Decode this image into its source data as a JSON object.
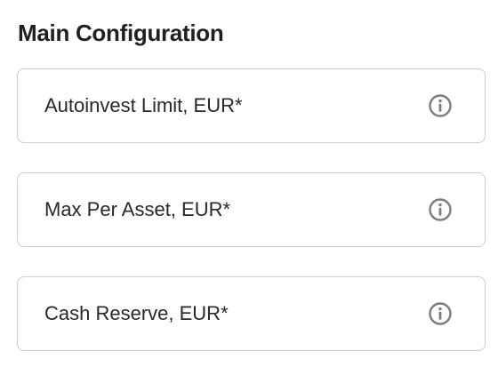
{
  "section": {
    "title": "Main Configuration"
  },
  "fields": [
    {
      "label": "Autoinvest Limit, EUR*",
      "icon": "info-icon"
    },
    {
      "label": "Max Per Asset, EUR*",
      "icon": "info-icon"
    },
    {
      "label": "Cash Reserve, EUR*",
      "icon": "info-icon"
    }
  ],
  "colors": {
    "border": "#c9ccd3",
    "text": "#1f2024",
    "icon": "#7b7d82"
  }
}
